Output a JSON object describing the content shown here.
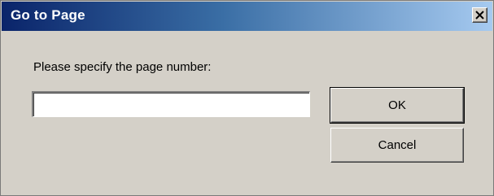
{
  "window": {
    "title": "Go to Page",
    "close_icon": "close-icon"
  },
  "form": {
    "prompt": "Please specify the page number:",
    "page_number_value": "",
    "page_number_placeholder": ""
  },
  "buttons": {
    "ok_label": "OK",
    "cancel_label": "Cancel"
  },
  "colors": {
    "dialog_background": "#d4d0c8",
    "titlebar_start": "#0a246a",
    "titlebar_end": "#a6caf0",
    "title_text": "#ffffff"
  }
}
